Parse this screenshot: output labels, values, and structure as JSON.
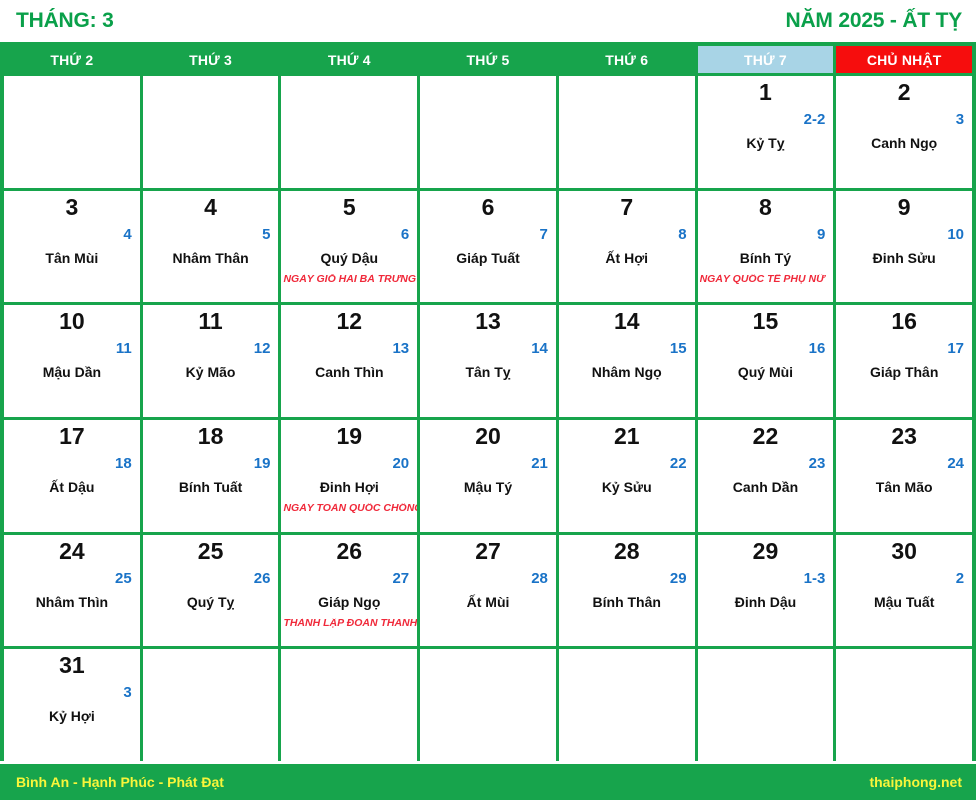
{
  "header": {
    "month_label": "THÁNG: 3",
    "year_label": "NĂM 2025 - ẤT TỴ"
  },
  "weekdays": [
    {
      "label": "THỨ 2",
      "type": "weekday"
    },
    {
      "label": "THỨ 3",
      "type": "weekday"
    },
    {
      "label": "THỨ 4",
      "type": "weekday"
    },
    {
      "label": "THỨ 5",
      "type": "weekday"
    },
    {
      "label": "THỨ 6",
      "type": "weekday"
    },
    {
      "label": "THỨ 7",
      "type": "saturday"
    },
    {
      "label": "CHỦ NHẬT",
      "type": "sunday"
    }
  ],
  "weeks": [
    [
      {
        "empty": true
      },
      {
        "empty": true
      },
      {
        "empty": true
      },
      {
        "empty": true
      },
      {
        "empty": true
      },
      {
        "solar": "1",
        "lunar": "2-2",
        "canchi": "Kỷ Tỵ",
        "event": ""
      },
      {
        "solar": "2",
        "lunar": "3",
        "canchi": "Canh Ngọ",
        "event": ""
      }
    ],
    [
      {
        "solar": "3",
        "lunar": "4",
        "canchi": "Tân Mùi",
        "event": ""
      },
      {
        "solar": "4",
        "lunar": "5",
        "canchi": "Nhâm Thân",
        "event": ""
      },
      {
        "solar": "5",
        "lunar": "6",
        "canchi": "Quý Dậu",
        "event": "NGÀY GIỖ HAI BÀ TRƯNG"
      },
      {
        "solar": "6",
        "lunar": "7",
        "canchi": "Giáp Tuất",
        "event": ""
      },
      {
        "solar": "7",
        "lunar": "8",
        "canchi": "Ất Hợi",
        "event": ""
      },
      {
        "solar": "8",
        "lunar": "9",
        "canchi": "Bính Tý",
        "event": "NGÀY QUỐC TẾ PHỤ NỮ"
      },
      {
        "solar": "9",
        "lunar": "10",
        "canchi": "Đinh Sửu",
        "event": ""
      }
    ],
    [
      {
        "solar": "10",
        "lunar": "11",
        "canchi": "Mậu Dần",
        "event": ""
      },
      {
        "solar": "11",
        "lunar": "12",
        "canchi": "Kỷ Mão",
        "event": ""
      },
      {
        "solar": "12",
        "lunar": "13",
        "canchi": "Canh Thìn",
        "event": ""
      },
      {
        "solar": "13",
        "lunar": "14",
        "canchi": "Tân Tỵ",
        "event": ""
      },
      {
        "solar": "14",
        "lunar": "15",
        "canchi": "Nhâm Ngọ",
        "event": ""
      },
      {
        "solar": "15",
        "lunar": "16",
        "canchi": "Quý Mùi",
        "event": ""
      },
      {
        "solar": "16",
        "lunar": "17",
        "canchi": "Giáp Thân",
        "event": ""
      }
    ],
    [
      {
        "solar": "17",
        "lunar": "18",
        "canchi": "Ất Dậu",
        "event": ""
      },
      {
        "solar": "18",
        "lunar": "19",
        "canchi": "Bính Tuất",
        "event": ""
      },
      {
        "solar": "19",
        "lunar": "20",
        "canchi": "Đinh Hợi",
        "event": "NGÀY TOÀN QUỐC CHỐNG LAO"
      },
      {
        "solar": "20",
        "lunar": "21",
        "canchi": "Mậu Tý",
        "event": ""
      },
      {
        "solar": "21",
        "lunar": "22",
        "canchi": "Kỷ Sửu",
        "event": ""
      },
      {
        "solar": "22",
        "lunar": "23",
        "canchi": "Canh Dần",
        "event": ""
      },
      {
        "solar": "23",
        "lunar": "24",
        "canchi": "Tân Mão",
        "event": ""
      }
    ],
    [
      {
        "solar": "24",
        "lunar": "25",
        "canchi": "Nhâm Thìn",
        "event": ""
      },
      {
        "solar": "25",
        "lunar": "26",
        "canchi": "Quý Tỵ",
        "event": ""
      },
      {
        "solar": "26",
        "lunar": "27",
        "canchi": "Giáp Ngọ",
        "event": "THÀNH LẬP ĐOÀN THANH NIÊN"
      },
      {
        "solar": "27",
        "lunar": "28",
        "canchi": "Ất Mùi",
        "event": ""
      },
      {
        "solar": "28",
        "lunar": "29",
        "canchi": "Bính Thân",
        "event": ""
      },
      {
        "solar": "29",
        "lunar": "1-3",
        "canchi": "Đinh Dậu",
        "event": ""
      },
      {
        "solar": "30",
        "lunar": "2",
        "canchi": "Mậu Tuất",
        "event": ""
      }
    ],
    [
      {
        "solar": "31",
        "lunar": "3",
        "canchi": "Kỷ Hợi",
        "event": ""
      },
      {
        "empty": true
      },
      {
        "empty": true
      },
      {
        "empty": true
      },
      {
        "empty": true
      },
      {
        "empty": true
      },
      {
        "empty": true
      }
    ]
  ],
  "footer": {
    "slogan": "Bình An - Hạnh Phúc - Phát Đạt",
    "site": "thaiphong.net"
  },
  "colors": {
    "green": "#17a44c",
    "title_green": "#0aa04a",
    "saturday_blue": "#a8d4e6",
    "sunday_red": "#f60d0d",
    "lunar_blue": "#1a73c7",
    "event_red": "#f0293a",
    "footer_yellow": "#f8f53a"
  }
}
